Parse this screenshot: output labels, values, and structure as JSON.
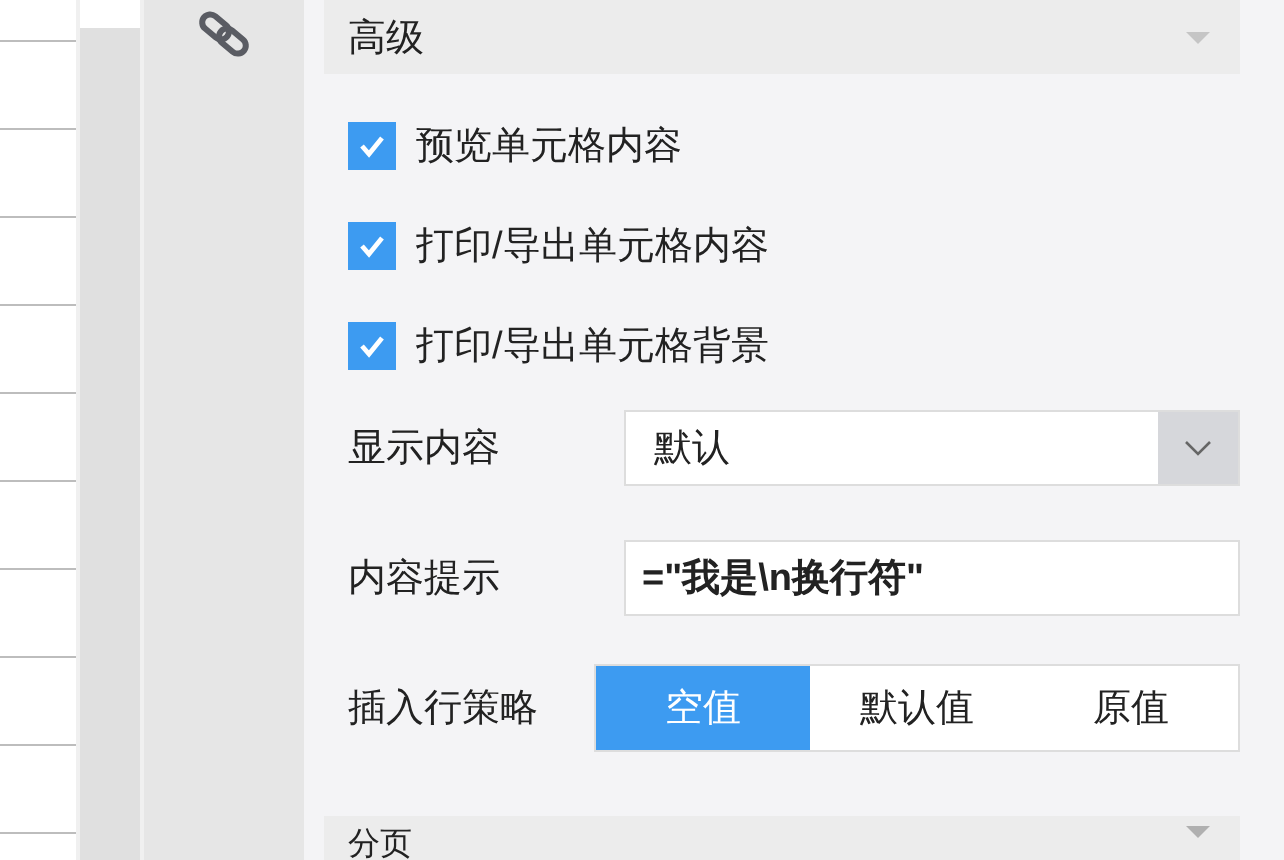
{
  "sections": [
    {
      "title": "高级",
      "expanded": true
    },
    {
      "title": "分页",
      "expanded": false
    }
  ],
  "checkboxes": [
    {
      "label": "预览单元格内容",
      "checked": true
    },
    {
      "label": "打印/导出单元格内容",
      "checked": true
    },
    {
      "label": "打印/导出单元格背景",
      "checked": true
    }
  ],
  "display_content": {
    "label": "显示内容",
    "value": "默认"
  },
  "content_tip": {
    "label": "内容提示",
    "value": "=\"我是\\n换行符\""
  },
  "insert_row_strategy": {
    "label": "插入行策略",
    "options": [
      {
        "label": "空值",
        "selected": true
      },
      {
        "label": "默认值",
        "selected": false
      },
      {
        "label": "原值",
        "selected": false
      }
    ]
  }
}
